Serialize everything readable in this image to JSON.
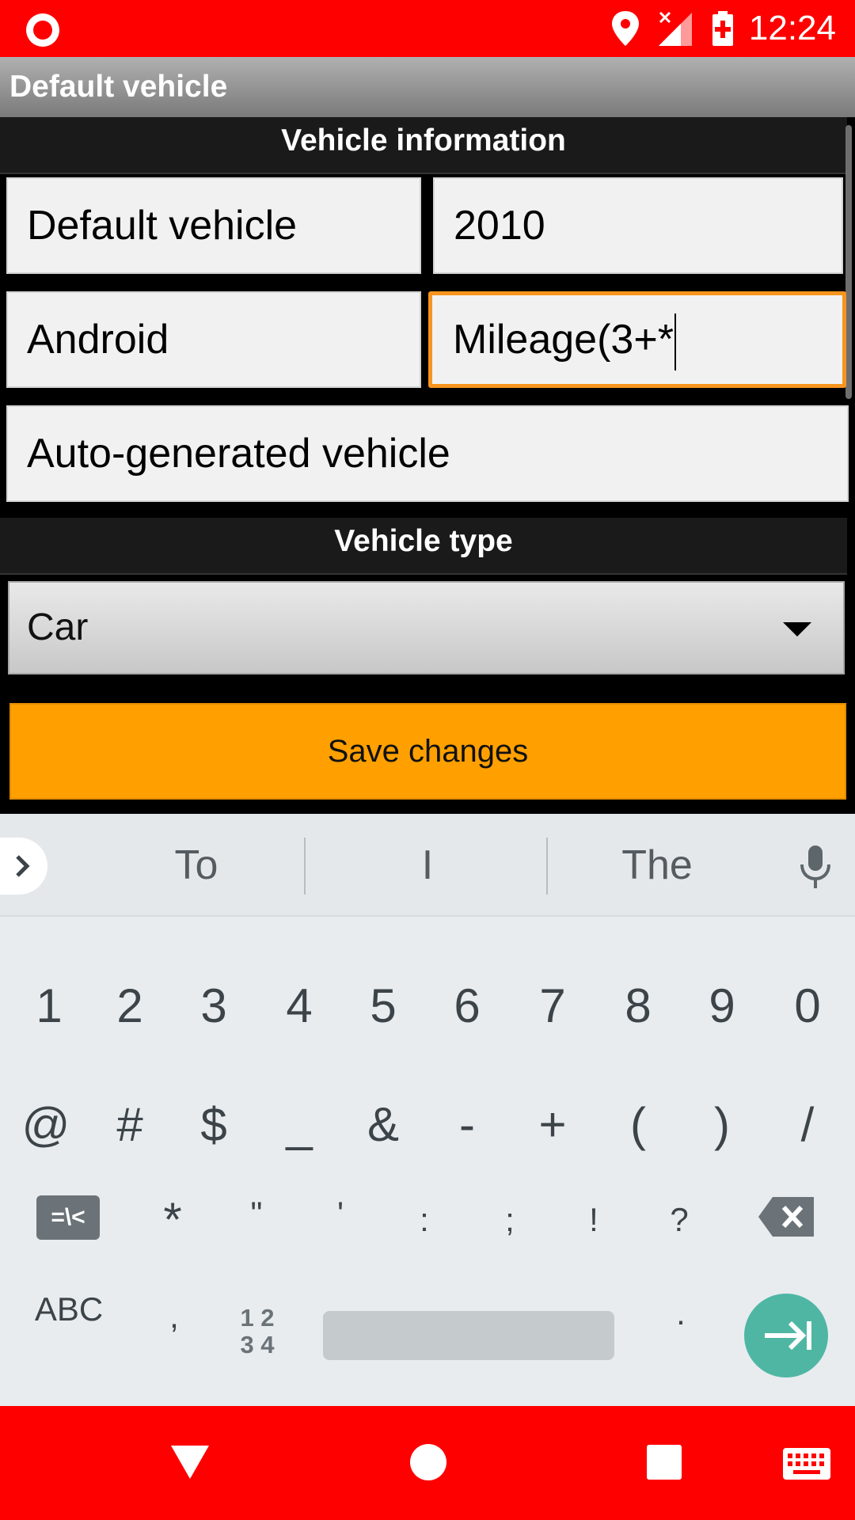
{
  "status_bar": {
    "time": "12:24",
    "icons": [
      "record-icon",
      "location-icon",
      "signal-icon",
      "battery-charging-icon"
    ],
    "background": "#ff0000"
  },
  "title_bar": {
    "title": "Default vehicle"
  },
  "vehicle_info": {
    "header": "Vehicle information",
    "name": "Default vehicle",
    "year": "2010",
    "make": "Android",
    "model": "Mileage(3+*",
    "description": "Auto-generated vehicle"
  },
  "vehicle_type": {
    "header": "Vehicle type",
    "selected": "Car"
  },
  "save_button": {
    "label": "Save changes",
    "color": "#ffa000"
  },
  "keyboard": {
    "suggestions": [
      "To",
      "I",
      "The"
    ],
    "row1": [
      "1",
      "2",
      "3",
      "4",
      "5",
      "6",
      "7",
      "8",
      "9",
      "0"
    ],
    "row2": [
      "@",
      "#",
      "$",
      "_",
      "&",
      "-",
      "+",
      "(",
      ")",
      "/"
    ],
    "row3_symbols_key": "=\\<",
    "row3": [
      "*",
      "\"",
      "'",
      ":",
      ";",
      "!",
      "?"
    ],
    "abc_key": "ABC",
    "comma": ",",
    "num_key_top": "1 2",
    "num_key_bottom": "3 4",
    "period": ".",
    "accent": "#4fb6a4"
  },
  "nav_bar": {
    "icons": [
      "back-icon",
      "home-icon",
      "recents-icon",
      "keyboard-icon"
    ],
    "background": "#ff0000"
  }
}
